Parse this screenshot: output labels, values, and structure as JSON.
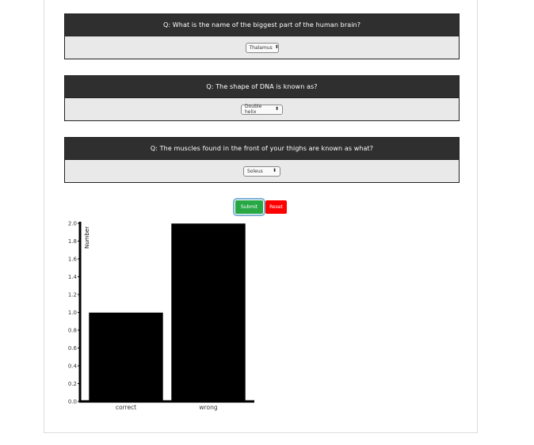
{
  "questions": [
    {
      "text": "Q: What is the name of the biggest part of the human brain?",
      "selected": "Thalamus"
    },
    {
      "text": "Q: The shape of DNA is known as?",
      "selected": "Double helix"
    },
    {
      "text": "Q: The muscles found in the front of your thighs are known as what?",
      "selected": "Soleus"
    }
  ],
  "buttons": {
    "submit_label": "Submit",
    "reset_label": "Reset"
  },
  "colors": {
    "submit": "#28a745",
    "reset": "#ff0000",
    "question_header": "#2f2f2f",
    "bar": "#000000"
  },
  "chart_data": {
    "type": "bar",
    "categories": [
      "correct",
      "wrong"
    ],
    "values": [
      1,
      2
    ],
    "ylabel": "Number",
    "ylim": [
      0,
      2.0
    ],
    "yticks": [
      "0.0",
      "0.2",
      "0.4",
      "0.6",
      "0.8",
      "1.0",
      "1.2",
      "1.4",
      "1.6",
      "1.8",
      "2.0"
    ]
  }
}
